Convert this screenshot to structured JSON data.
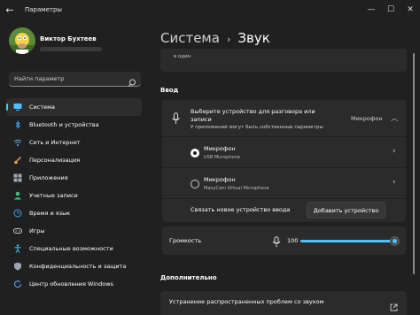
{
  "window": {
    "title": "Параметры",
    "back_icon": "back-arrow-icon",
    "controls": [
      "minimize-icon",
      "maximize-icon",
      "close-icon"
    ]
  },
  "profile": {
    "name": "Виктор Бухтеев"
  },
  "search": {
    "placeholder": "Найти параметр"
  },
  "sidebar": {
    "items": [
      {
        "label": "Система",
        "icon": "monitor-icon",
        "color": "#4cc2ff",
        "active": true
      },
      {
        "label": "Bluetooth и устройства",
        "icon": "bluetooth-icon",
        "color": "#3a9ae8"
      },
      {
        "label": "Сеть и Интернет",
        "icon": "wifi-icon",
        "color": "#6aa5d8"
      },
      {
        "label": "Персонализация",
        "icon": "brush-icon",
        "color": "#e7a35a"
      },
      {
        "label": "Приложения",
        "icon": "apps-icon",
        "color": "#a0a8b8"
      },
      {
        "label": "Учетные записи",
        "icon": "account-icon",
        "color": "#3fbf7f"
      },
      {
        "label": "Время и язык",
        "icon": "globe-clock-icon",
        "color": "#3aa0e8"
      },
      {
        "label": "Игры",
        "icon": "gamepad-icon",
        "color": "#c8c8c8"
      },
      {
        "label": "Специальные возможности",
        "icon": "accessibility-icon",
        "color": "#4cc2ff"
      },
      {
        "label": "Конфиденциальность и защита",
        "icon": "shield-icon",
        "color": "#9aa4b4"
      },
      {
        "label": "Центр обновления Windows",
        "icon": "update-icon",
        "color": "#4c9ae8"
      }
    ]
  },
  "breadcrumb": {
    "parent": "Система",
    "separator": "›",
    "current": "Звук"
  },
  "top_card": {
    "text": "в один"
  },
  "input_section": {
    "title": "Ввод",
    "device_title": "Выберите устройство для разговора или записи",
    "device_subtitle": "У приложений могут быть собственные параметры",
    "selected_value": "Микрофон",
    "devices": [
      {
        "name": "Микрофон",
        "sub": "USB Microphone",
        "selected": true
      },
      {
        "name": "Микрофон",
        "sub": "ManyCam Virtual Microphone",
        "selected": false
      }
    ],
    "pair_label": "Связать новое устройство ввода",
    "pair_button": "Добавить устройство",
    "volume_label": "Громкость",
    "volume_value": "100",
    "volume_level": 1.0
  },
  "more_section": {
    "title": "Дополнительно",
    "troubleshoot": "Устранение распространенных проблем со звуком"
  },
  "colors": {
    "accent": "#4cc2ff",
    "background": "#202020",
    "card": "#2b2b2b"
  }
}
